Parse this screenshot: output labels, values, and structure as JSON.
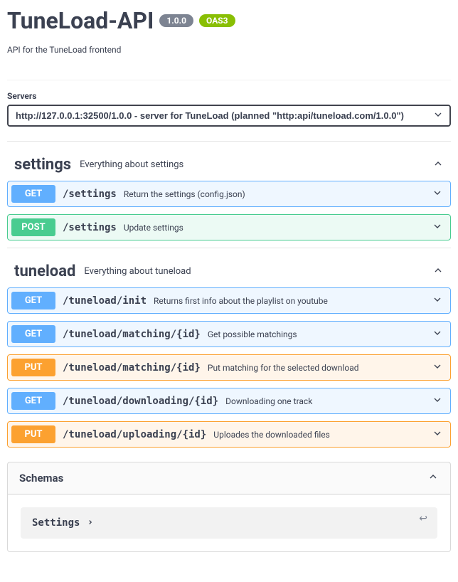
{
  "header": {
    "title": "TuneLoad-API",
    "version": "1.0.0",
    "oas_badge": "OAS3",
    "description": "API for the TuneLoad frontend"
  },
  "servers": {
    "label": "Servers",
    "selected": "http://127.0.0.1:32500/1.0.0 - server for TuneLoad (planned \"http:api/tuneload.com/1.0.0\")"
  },
  "tags": [
    {
      "name": "settings",
      "description": "Everything about settings",
      "operations": [
        {
          "method": "GET",
          "path": "/settings",
          "summary": "Return the settings (config.json)"
        },
        {
          "method": "POST",
          "path": "/settings",
          "summary": "Update settings"
        }
      ]
    },
    {
      "name": "tuneload",
      "description": "Everything about tuneload",
      "operations": [
        {
          "method": "GET",
          "path": "/tuneload/init",
          "summary": "Returns first info about the playlist on youtube"
        },
        {
          "method": "GET",
          "path": "/tuneload/matching/{id}",
          "summary": "Get possible matchings"
        },
        {
          "method": "PUT",
          "path": "/tuneload/matching/{id}",
          "summary": "Put matching for the selected download"
        },
        {
          "method": "GET",
          "path": "/tuneload/downloading/{id}",
          "summary": "Downloading one track"
        },
        {
          "method": "PUT",
          "path": "/tuneload/uploading/{id}",
          "summary": "Uploades the downloaded files"
        }
      ]
    }
  ],
  "schemas": {
    "title": "Schemas",
    "items": [
      {
        "name": "Settings"
      }
    ],
    "curl_hint": "↩"
  }
}
